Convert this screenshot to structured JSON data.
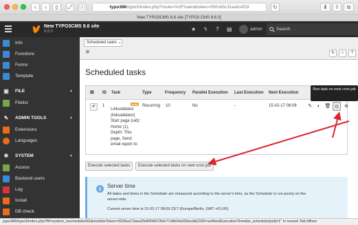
{
  "browser": {
    "url_host": "typo386",
    "url_path": "/typo3/index.php?route=%2Fmain&token=050cb5c31eafc4f19",
    "tab_title": "New TYPO3CMS 8.6 site [TYPO3 CMS 8.6.0]"
  },
  "topbar": {
    "site_name": "New TYPO3CMS 8.6 site",
    "version": "8.6.0",
    "username": "admin",
    "search_label": "Search"
  },
  "sidebar": {
    "items": [
      {
        "label": "Info",
        "icon": "info-icon",
        "color": "#3b8ad8"
      },
      {
        "label": "Functions",
        "icon": "functions-icon",
        "color": "#3b8ad8"
      },
      {
        "label": "Forms",
        "icon": "forms-icon",
        "color": "#3b8ad8"
      },
      {
        "label": "Template",
        "icon": "template-icon",
        "color": "#3b8ad8"
      },
      {
        "label": "FILE",
        "icon": "file-icon",
        "color": "#333333"
      },
      {
        "label": "Filelist",
        "icon": "filelist-icon",
        "color": "#74a84b"
      },
      {
        "label": "ADMIN TOOLS",
        "icon": "admin-tools-icon",
        "color": "#333333"
      },
      {
        "label": "Extensions",
        "icon": "extensions-icon",
        "color": "#ec6b1d"
      },
      {
        "label": "Languages",
        "icon": "languages-icon",
        "color": "#ec6b1d"
      },
      {
        "label": "SYSTEM",
        "icon": "system-icon",
        "color": "#333333"
      },
      {
        "label": "Access",
        "icon": "access-icon",
        "color": "#74a84b"
      },
      {
        "label": "Backend users",
        "icon": "backend-users-icon",
        "color": "#3b8ad8"
      },
      {
        "label": "Log",
        "icon": "log-icon",
        "color": "#d8333f"
      },
      {
        "label": "Install",
        "icon": "install-icon",
        "color": "#ec6b1d"
      },
      {
        "label": "DB check",
        "icon": "db-check-icon",
        "color": "#ec6b1d"
      }
    ]
  },
  "docheader": {
    "selector_value": "Scheduled tasks"
  },
  "main": {
    "title": "Scheduled tasks",
    "columns": [
      "ID",
      "Task",
      "Type",
      "Frequency",
      "Parallel Execution",
      "Last Execution",
      "Next Execution"
    ],
    "row": {
      "id": "1",
      "badge": "beta",
      "description": "Linkvalidator (linkvalidator) Start page (uid): Home (1), Depth: This page, Send email report to:",
      "type": "Recurring",
      "frequency": "10",
      "parallel": "No",
      "last_execution": "-",
      "next_execution": "15-02-17 08:08"
    },
    "tooltip": "Run task on next cron job",
    "button_execute": "Execute selected tasks",
    "button_execute_cron": "Execute selected tasks on next cron job"
  },
  "info": {
    "title": "Server time",
    "text": "All dates and times in the Scheduler are measured according to the server's time, as the Scheduler is run purely on the server-side.",
    "current": "Current server time is 15-02-17 08:09 CET (Europe/Berlin, GMT +01:00)."
  },
  "statusbar": {
    "text": "„typo386/typo3/index.php?M=system_txschedulerM1&moduleToken=9206ea73aea2fef05fd972bfc77efb04a939ecd&CMD=setNextExecutionTime&tx_scheduler[uid]=1\" in neuem Tab öffnen"
  },
  "colors": {
    "accent_orange": "#ff8700",
    "arrow_red": "#d8262c"
  }
}
